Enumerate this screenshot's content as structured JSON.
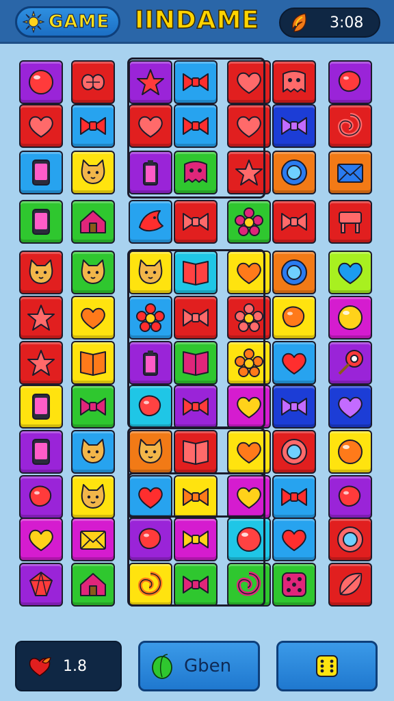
{
  "header": {
    "game_label": "GAME",
    "title": "IINDAME",
    "timer": "3:08",
    "sun_icon": "sun-icon",
    "timer_icon": "fire-leaf-icon"
  },
  "footer": {
    "lives_value": "1.8",
    "lives_icon": "heart-leaf-icon",
    "middle_label": "Gben",
    "middle_icon": "leaf-icon",
    "dice_icon": "dice-icon"
  },
  "colors": {
    "purple": "#9a24d8",
    "red": "#e11f1f",
    "blue": "#27a3ef",
    "yellow": "#ffe30f",
    "green": "#2fc72f",
    "orange": "#f27a16",
    "magenta": "#d51ccf",
    "navy": "#1c3dd6",
    "cyan": "#1fc6e6",
    "lime": "#a8f020",
    "topbar": "#2a66a8",
    "background": "#a8d2ef"
  },
  "tiles": [
    {
      "c": "purple",
      "i": "bubble"
    },
    {
      "c": "red",
      "i": "knot"
    },
    {
      "c": "purple",
      "i": "star"
    },
    {
      "c": "blue",
      "i": "bow"
    },
    {
      "c": "red",
      "i": "heart"
    },
    {
      "c": "red",
      "i": "ghost"
    },
    {
      "c": "purple",
      "i": "bean"
    },
    {
      "c": "red",
      "i": "heart"
    },
    {
      "c": "blue",
      "i": "bow"
    },
    {
      "c": "red",
      "i": "heart"
    },
    {
      "c": "blue",
      "i": "bow"
    },
    {
      "c": "red",
      "i": "heart"
    },
    {
      "c": "navy",
      "i": "bow"
    },
    {
      "c": "red",
      "i": "swirl"
    },
    {
      "c": "blue",
      "i": "phone"
    },
    {
      "c": "yellow",
      "i": "cat"
    },
    {
      "c": "purple",
      "i": "battery"
    },
    {
      "c": "green",
      "i": "ghost"
    },
    {
      "c": "red",
      "i": "star"
    },
    {
      "c": "orange",
      "i": "ring"
    },
    {
      "c": "orange",
      "i": "envelope"
    },
    {
      "c": "green",
      "i": "phone"
    },
    {
      "c": "green",
      "i": "house"
    },
    {
      "c": "blue",
      "i": "bird"
    },
    {
      "c": "red",
      "i": "bow"
    },
    {
      "c": "green",
      "i": "flower"
    },
    {
      "c": "red",
      "i": "bow"
    },
    {
      "c": "red",
      "i": "stool"
    },
    {
      "c": "red",
      "i": "cat"
    },
    {
      "c": "green",
      "i": "cat"
    },
    {
      "c": "yellow",
      "i": "cat"
    },
    {
      "c": "cyan",
      "i": "book"
    },
    {
      "c": "yellow",
      "i": "heart"
    },
    {
      "c": "orange",
      "i": "ring"
    },
    {
      "c": "lime",
      "i": "heart"
    },
    {
      "c": "red",
      "i": "star"
    },
    {
      "c": "yellow",
      "i": "heart"
    },
    {
      "c": "blue",
      "i": "flower"
    },
    {
      "c": "red",
      "i": "bow"
    },
    {
      "c": "red",
      "i": "flower"
    },
    {
      "c": "yellow",
      "i": "bean"
    },
    {
      "c": "magenta",
      "i": "bubble"
    },
    {
      "c": "red",
      "i": "star"
    },
    {
      "c": "yellow",
      "i": "book"
    },
    {
      "c": "purple",
      "i": "battery"
    },
    {
      "c": "green",
      "i": "book"
    },
    {
      "c": "yellow",
      "i": "flower"
    },
    {
      "c": "blue",
      "i": "heart"
    },
    {
      "c": "purple",
      "i": "candy"
    },
    {
      "c": "yellow",
      "i": "phone"
    },
    {
      "c": "green",
      "i": "bow"
    },
    {
      "c": "cyan",
      "i": "bean"
    },
    {
      "c": "purple",
      "i": "bow"
    },
    {
      "c": "magenta",
      "i": "heart"
    },
    {
      "c": "navy",
      "i": "bow"
    },
    {
      "c": "navy",
      "i": "heart"
    },
    {
      "c": "purple",
      "i": "phone"
    },
    {
      "c": "blue",
      "i": "cat"
    },
    {
      "c": "orange",
      "i": "cat"
    },
    {
      "c": "red",
      "i": "book"
    },
    {
      "c": "yellow",
      "i": "heart"
    },
    {
      "c": "red",
      "i": "ring"
    },
    {
      "c": "yellow",
      "i": "bubble"
    },
    {
      "c": "purple",
      "i": "bean"
    },
    {
      "c": "yellow",
      "i": "cat"
    },
    {
      "c": "blue",
      "i": "heart"
    },
    {
      "c": "yellow",
      "i": "bow"
    },
    {
      "c": "magenta",
      "i": "heart"
    },
    {
      "c": "blue",
      "i": "bow"
    },
    {
      "c": "purple",
      "i": "bean"
    },
    {
      "c": "magenta",
      "i": "heart"
    },
    {
      "c": "magenta",
      "i": "envelope"
    },
    {
      "c": "purple",
      "i": "bean"
    },
    {
      "c": "magenta",
      "i": "bow"
    },
    {
      "c": "cyan",
      "i": "bubble"
    },
    {
      "c": "blue",
      "i": "heart"
    },
    {
      "c": "red",
      "i": "ring"
    },
    {
      "c": "purple",
      "i": "gem"
    },
    {
      "c": "green",
      "i": "house"
    },
    {
      "c": "yellow",
      "i": "swirl"
    },
    {
      "c": "green",
      "i": "bow"
    },
    {
      "c": "green",
      "i": "swirl"
    },
    {
      "c": "green",
      "i": "dice"
    },
    {
      "c": "red",
      "i": "leaf"
    }
  ]
}
